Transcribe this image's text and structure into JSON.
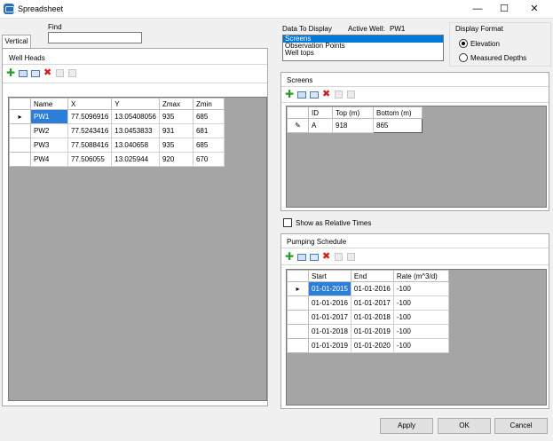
{
  "window": {
    "title": "Spreadsheet",
    "minimize": "—",
    "maximize": "☐",
    "close": "✕"
  },
  "find": {
    "label": "Find",
    "value": "",
    "tab_label": "Vertical"
  },
  "well_heads": {
    "title": "Well Heads",
    "columns": [
      "Name",
      "X",
      "Y",
      "Zmax",
      "Zmin"
    ],
    "rows": [
      [
        "PW1",
        "77.5096916",
        "13.05408056",
        "935",
        "685"
      ],
      [
        "PW2",
        "77.5243416",
        "13.0453833",
        "931",
        "681"
      ],
      [
        "PW3",
        "77.5088416",
        "13.040658",
        "935",
        "685"
      ],
      [
        "PW4",
        "77.506055",
        "13.025944",
        "920",
        "670"
      ]
    ],
    "current_row_marker": "▸"
  },
  "data_to_display": {
    "label": "Data To Display",
    "active_well_label": "Active Well:",
    "active_well": "PW1",
    "options": [
      "Screens",
      "Observation Points",
      "Well tops"
    ],
    "selected": "Screens"
  },
  "display_format": {
    "label": "Display Format",
    "options": [
      "Elevation",
      "Measured Depths"
    ],
    "selected": "Elevation"
  },
  "screens": {
    "title": "Screens",
    "columns": [
      "ID",
      "Top (m)",
      "Bottom (m)"
    ],
    "rows": [
      [
        "A",
        "918",
        "865"
      ]
    ],
    "edit_marker": "✎"
  },
  "show_relative": {
    "label": "Show as Relative Times",
    "checked": false
  },
  "pumping": {
    "title": "Pumping Schedule",
    "columns": [
      "Start",
      "End",
      "Rate (m^3/d)"
    ],
    "rows": [
      [
        "01-01-2015",
        "01-01-2016",
        "-100"
      ],
      [
        "01-01-2016",
        "01-01-2017",
        "-100"
      ],
      [
        "01-01-2017",
        "01-01-2018",
        "-100"
      ],
      [
        "01-01-2018",
        "01-01-2019",
        "-100"
      ],
      [
        "01-01-2019",
        "01-01-2020",
        "-100"
      ]
    ],
    "current_row_marker": "▸"
  },
  "buttons": {
    "apply": "Apply",
    "ok": "OK",
    "cancel": "Cancel"
  },
  "colors": {
    "selection": "#2d7ed8",
    "grid_bg": "#a5a5a5",
    "list_selection": "#0078d7"
  }
}
